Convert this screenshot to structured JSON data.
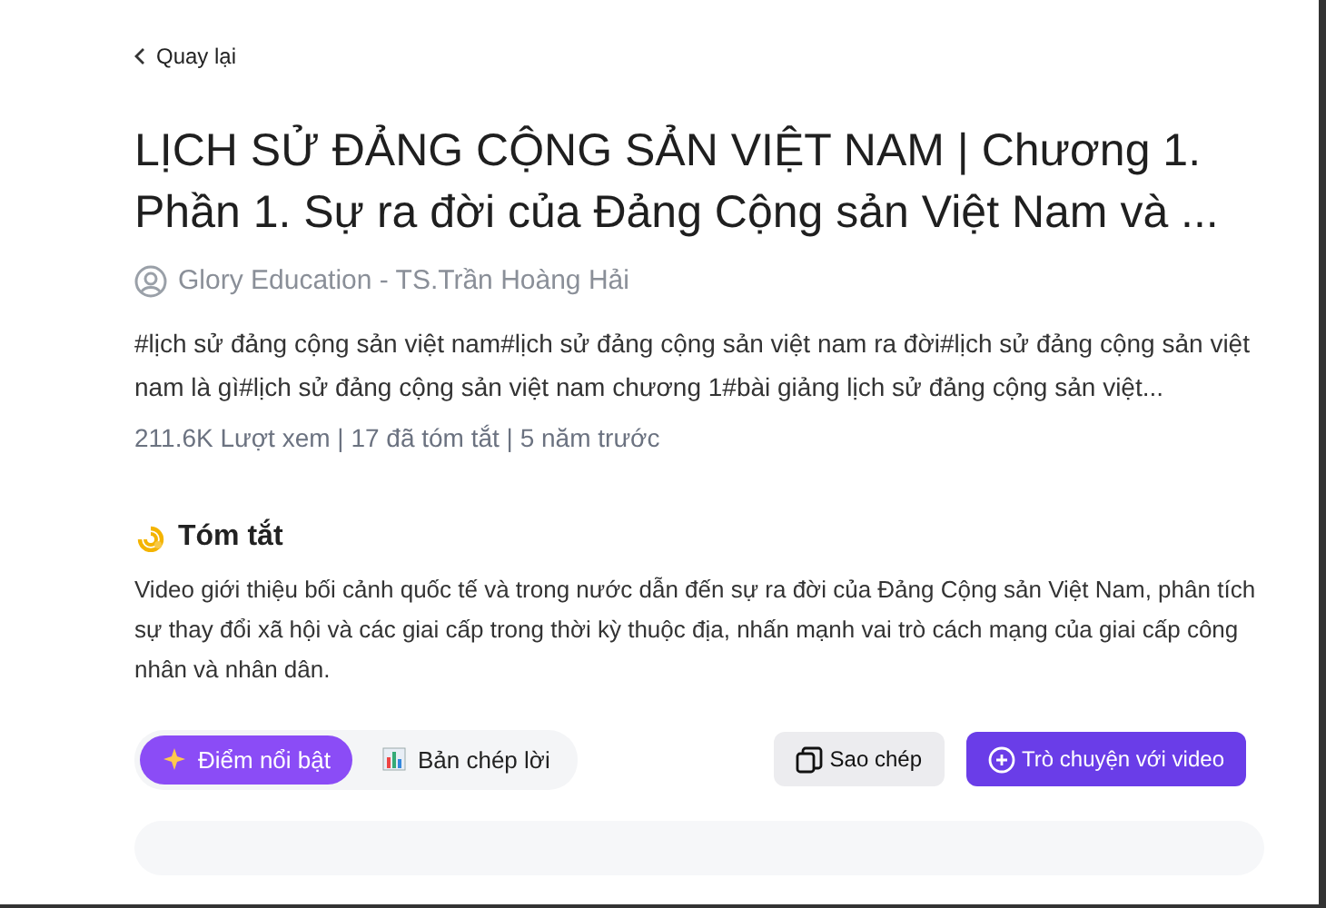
{
  "back_link": {
    "label": "Quay lại"
  },
  "title": "LỊCH SỬ ĐẢNG CỘNG SẢN VIỆT NAM | Chương 1. Phần 1. Sự ra đời của Đảng Cộng sản Việt Nam và ...",
  "channel": "Glory Education - TS.Trần Hoàng Hải",
  "tags": "#lịch sử đảng cộng sản việt nam#lịch sử đảng cộng sản việt nam ra đời#lịch sử đảng cộng sản việt nam là gì#lịch sử đảng cộng sản việt nam chương 1#bài giảng lịch sử đảng cộng sản việt...",
  "stats": "211.6K Lượt xem | 17 đã tóm tắt | 5 năm trước",
  "summary": {
    "heading": "Tóm tắt",
    "text": "Video giới thiệu bối cảnh quốc tế và trong nước dẫn đến sự ra đời của Đảng Cộng sản Việt Nam, phân tích sự thay đổi xã hội và các giai cấp trong thời kỳ thuộc địa, nhấn mạnh vai trò cách mạng của giai cấp công nhân và nhân dân."
  },
  "tabs": [
    {
      "label": "Điểm nổi bật",
      "kind": "sparkle",
      "selected": true
    },
    {
      "label": "Bản chép lời",
      "kind": "chart",
      "selected": false
    }
  ],
  "buttons": [
    {
      "label": "Sao chép",
      "kind": "copy"
    },
    {
      "label": "Trò chuyện với video",
      "kind": "chat"
    }
  ]
}
